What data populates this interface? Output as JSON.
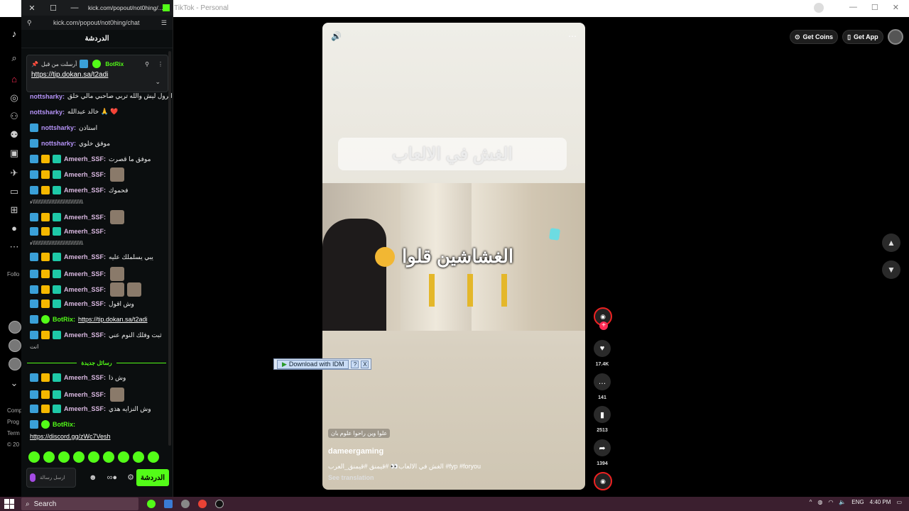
{
  "background_tab": {
    "title": "TikTok - Personal"
  },
  "tiktok": {
    "footer_following": "Follo",
    "footer_links": [
      "Comp",
      "Prog",
      "Term",
      "© 20"
    ],
    "top_actions": {
      "get_coins": "Get Coins",
      "get_app": "Get App"
    },
    "video": {
      "banner_text": "الغش في الالعاب",
      "scene_text": "الغشاشين قلوا",
      "caption_tag": "علوا وين راحوا علوم بان",
      "creator": "dameergaming",
      "description": "الغش في الالعاب👀 #قيمنق #قيمنق_العرب #fyp #foryou",
      "see_translation": "See translation"
    },
    "actions": [
      {
        "name": "like",
        "count": "17.4K"
      },
      {
        "name": "comment",
        "count": "141"
      },
      {
        "name": "save",
        "count": "2513"
      },
      {
        "name": "share",
        "count": "1394"
      }
    ]
  },
  "idm": {
    "label": "Download with IDM",
    "help": "?",
    "close": "X"
  },
  "popout": {
    "title": "kick.com/popout/not0hing/...",
    "url": "kick.com/popout/not0hing/chat",
    "chat_header": "الدردشة",
    "pinned": {
      "pinned_by_label": "أرسلت من قبل",
      "username": "BotRix",
      "link": "https://tip.dokan.sa/t2adi"
    },
    "messages": [
      {
        "user": "nottsharky:",
        "text": "اترول ليش والله تربي صاحبي مالي خلق"
      },
      {
        "user": "nottsharky:",
        "text": "خالد عبدالله 🙏 ❤️"
      },
      {
        "user": "nottsharky:",
        "text": "استاذن"
      },
      {
        "user": "nottsharky:",
        "text": "موفق خلوي"
      },
      {
        "user": "Ameerh_SSF:",
        "text": "موفق ما قصرت"
      },
      {
        "user": "Ameerh_SSF:",
        "text": ""
      },
      {
        "user": "Ameerh_SSF:",
        "text": "فحموك"
      },
      {
        "user": "",
        "text": "ء\\\\\\\\\\\\\\\\\\\\\\\\\\\\\\\\\\\\\\\\\\\\\\\\\\\\\\\\\\\\\\\\"
      },
      {
        "user": "Ameerh_SSF:",
        "text": ""
      },
      {
        "user": "Ameerh_SSF:",
        "text": ""
      },
      {
        "user": "",
        "text": "ء\\\\\\\\\\\\\\\\\\\\\\\\\\\\\\\\\\\\\\\\\\\\\\\\\\\\\\\\\\\\\\\\"
      },
      {
        "user": "Ameerh_SSF:",
        "text": "يبي يسلملك عليه"
      },
      {
        "user": "Ameerh_SSF:",
        "text": ""
      },
      {
        "user": "Ameerh_SSF:",
        "text": ""
      },
      {
        "user": "Ameerh_SSF:",
        "text": "وش اقول"
      },
      {
        "user": "BotRix:",
        "text": "https://tip.dokan.sa/t2adi"
      },
      {
        "user": "Ameerh_SSF:",
        "text": "ثبت وفلك النوم عني"
      },
      {
        "user": "",
        "text": "انت"
      }
    ],
    "new_messages_label": "رسائل جديدة",
    "new_messages": [
      {
        "user": "Ameerh_SSF:",
        "text": "وش ذا"
      },
      {
        "user": "Ameerh_SSF:",
        "text": ""
      },
      {
        "user": "Ameerh_SSF:",
        "text": "وش النزايه هذي"
      },
      {
        "user": "BotRix:",
        "text": ""
      },
      {
        "user": "",
        "text": "https://discord.gg/zWc7Vesh"
      }
    ],
    "composer_placeholder": "ارسل رسالة",
    "chat_button": "الدردشة"
  },
  "taskbar": {
    "search": "Search",
    "lang": "ENG",
    "time": "4:40 PM"
  }
}
